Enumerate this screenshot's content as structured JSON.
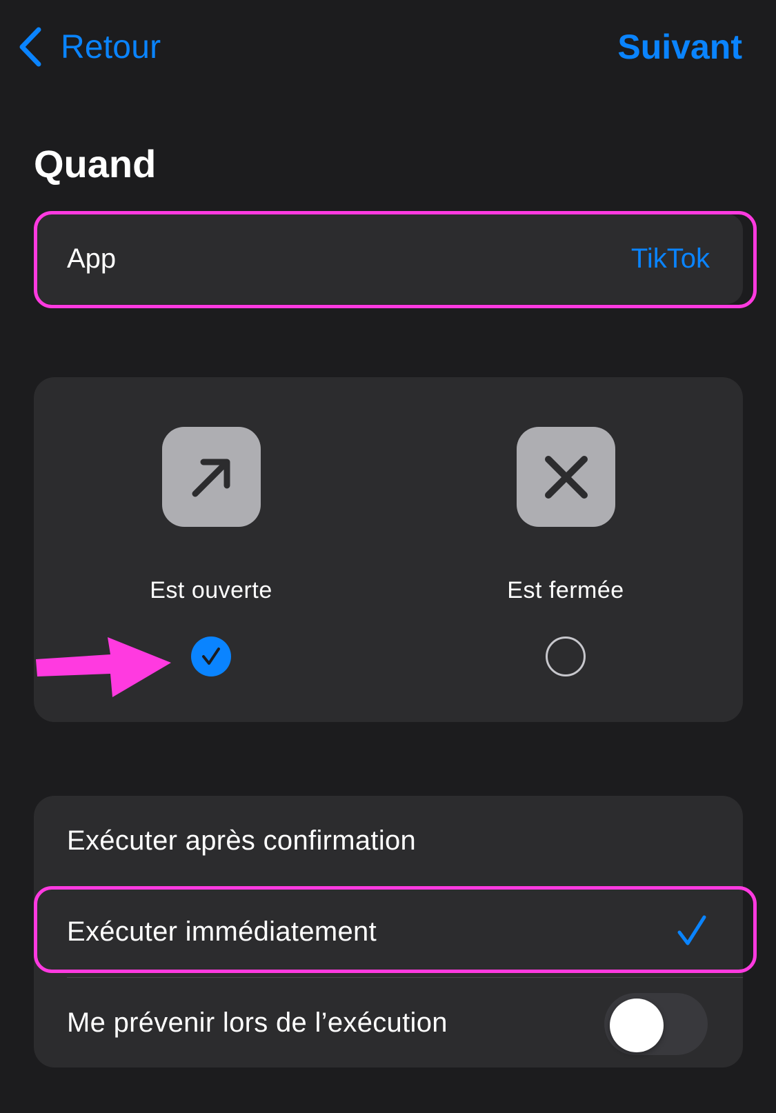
{
  "nav": {
    "back_label": "Retour",
    "next_label": "Suivant",
    "back_icon": "chevron-left-icon"
  },
  "section_title": "Quand",
  "app_row": {
    "label": "App",
    "value": "TikTok"
  },
  "states": [
    {
      "label": "Est ouverte",
      "icon": "arrow-up-right-icon",
      "selected": true
    },
    {
      "label": "Est fermée",
      "icon": "x-mark-icon",
      "selected": false
    }
  ],
  "run_options": {
    "confirm_label": "Exécuter après confirmation",
    "immediate_label": "Exécuter immédiatement",
    "immediate_selected": true,
    "notify_label": "Me prévenir lors de l’exécution",
    "notify_enabled": false
  },
  "colors": {
    "accent": "#0a84ff",
    "background": "#1c1c1e",
    "card": "#2c2c2e",
    "icon_tile": "#aeaeb2",
    "annotation": "#ff3ae0"
  }
}
